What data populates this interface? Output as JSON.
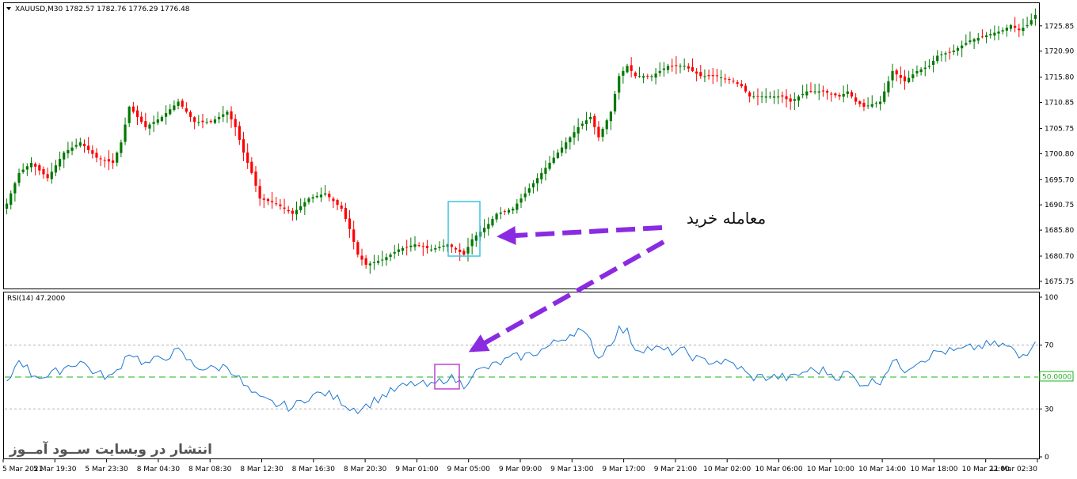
{
  "chart_data": [
    {
      "type": "candlestick",
      "symbol_header": "XAUUSD,M30  1782.57 1782.76 1776.29 1776.48",
      "ylim": [
        1674.5,
        1730
      ],
      "price_ticks": [
        "1725.85",
        "1720.90",
        "1715.80",
        "1710.85",
        "1705.75",
        "1700.80",
        "1695.70",
        "1690.75",
        "1685.80",
        "1680.70",
        "1675.75"
      ],
      "up_color": "#007800",
      "down_color": "#ff0000",
      "anchors": [
        [
          0,
          1691
        ],
        [
          3,
          1697
        ],
        [
          6,
          1699
        ],
        [
          10,
          1696
        ],
        [
          14,
          1701
        ],
        [
          18,
          1703
        ],
        [
          22,
          1700
        ],
        [
          26,
          1699
        ],
        [
          28,
          1703
        ],
        [
          30,
          1710
        ],
        [
          34,
          1706
        ],
        [
          38,
          1708
        ],
        [
          42,
          1711
        ],
        [
          46,
          1707
        ],
        [
          50,
          1707
        ],
        [
          54,
          1709
        ],
        [
          56,
          1706
        ],
        [
          58,
          1701
        ],
        [
          60,
          1697
        ],
        [
          62,
          1692
        ],
        [
          66,
          1691
        ],
        [
          70,
          1689
        ],
        [
          74,
          1692
        ],
        [
          78,
          1693
        ],
        [
          82,
          1690
        ],
        [
          84,
          1686
        ],
        [
          86,
          1681
        ],
        [
          88,
          1679
        ],
        [
          92,
          1680
        ],
        [
          96,
          1682
        ],
        [
          100,
          1683
        ],
        [
          104,
          1682
        ],
        [
          108,
          1683
        ],
        [
          110,
          1682
        ],
        [
          112,
          1681
        ],
        [
          114,
          1684
        ],
        [
          118,
          1687
        ],
        [
          120,
          1689
        ],
        [
          124,
          1690
        ],
        [
          128,
          1694
        ],
        [
          132,
          1698
        ],
        [
          136,
          1702
        ],
        [
          140,
          1706
        ],
        [
          143,
          1708
        ],
        [
          145,
          1704
        ],
        [
          148,
          1709
        ],
        [
          150,
          1716
        ],
        [
          152,
          1718
        ],
        [
          154,
          1716
        ],
        [
          158,
          1716
        ],
        [
          162,
          1718
        ],
        [
          166,
          1718
        ],
        [
          170,
          1716
        ],
        [
          174,
          1716
        ],
        [
          178,
          1715
        ],
        [
          180,
          1714
        ],
        [
          182,
          1712
        ],
        [
          186,
          1712
        ],
        [
          190,
          1712
        ],
        [
          192,
          1711
        ],
        [
          196,
          1713
        ],
        [
          200,
          1713
        ],
        [
          204,
          1712
        ],
        [
          206,
          1713
        ],
        [
          208,
          1711
        ],
        [
          210,
          1710
        ],
        [
          214,
          1711
        ],
        [
          217,
          1717
        ],
        [
          220,
          1715
        ],
        [
          223,
          1717
        ],
        [
          226,
          1718
        ],
        [
          228,
          1720
        ],
        [
          232,
          1721
        ],
        [
          236,
          1723
        ],
        [
          240,
          1724
        ],
        [
          244,
          1725
        ],
        [
          246,
          1726
        ],
        [
          248,
          1725
        ],
        [
          250,
          1726
        ],
        [
          252,
          1728
        ]
      ],
      "candle_count": 253
    },
    {
      "type": "line",
      "indicator_header": "RSI(14) 47.2000",
      "ylim": [
        0,
        100
      ],
      "rsi_ticks": [
        "100",
        "70",
        "30",
        "0"
      ],
      "levels": [
        70,
        50,
        30
      ],
      "level_label": "50.0000",
      "line_color": "#1e78d2",
      "level_color": "#22b022",
      "anchors": [
        [
          0,
          45
        ],
        [
          3,
          62
        ],
        [
          6,
          52
        ],
        [
          10,
          50
        ],
        [
          14,
          56
        ],
        [
          18,
          60
        ],
        [
          22,
          52
        ],
        [
          26,
          50
        ],
        [
          28,
          58
        ],
        [
          30,
          66
        ],
        [
          34,
          58
        ],
        [
          38,
          62
        ],
        [
          42,
          66
        ],
        [
          46,
          57
        ],
        [
          50,
          55
        ],
        [
          54,
          57
        ],
        [
          56,
          52
        ],
        [
          58,
          45
        ],
        [
          60,
          40
        ],
        [
          62,
          36
        ],
        [
          66,
          33
        ],
        [
          70,
          31
        ],
        [
          74,
          38
        ],
        [
          78,
          40
        ],
        [
          82,
          35
        ],
        [
          84,
          31
        ],
        [
          86,
          30
        ],
        [
          88,
          32
        ],
        [
          92,
          38
        ],
        [
          96,
          43
        ],
        [
          100,
          46
        ],
        [
          104,
          44
        ],
        [
          108,
          50
        ],
        [
          110,
          48
        ],
        [
          112,
          45
        ],
        [
          114,
          52
        ],
        [
          118,
          56
        ],
        [
          120,
          58
        ],
        [
          124,
          62
        ],
        [
          128,
          64
        ],
        [
          132,
          68
        ],
        [
          136,
          74
        ],
        [
          140,
          80
        ],
        [
          143,
          72
        ],
        [
          145,
          62
        ],
        [
          148,
          72
        ],
        [
          150,
          80
        ],
        [
          152,
          78
        ],
        [
          154,
          68
        ],
        [
          158,
          68
        ],
        [
          162,
          66
        ],
        [
          166,
          66
        ],
        [
          170,
          60
        ],
        [
          174,
          60
        ],
        [
          178,
          58
        ],
        [
          180,
          55
        ],
        [
          182,
          50
        ],
        [
          186,
          50
        ],
        [
          190,
          50
        ],
        [
          192,
          49
        ],
        [
          196,
          54
        ],
        [
          200,
          54
        ],
        [
          204,
          50
        ],
        [
          206,
          53
        ],
        [
          208,
          48
        ],
        [
          210,
          46
        ],
        [
          214,
          48
        ],
        [
          217,
          60
        ],
        [
          220,
          55
        ],
        [
          223,
          60
        ],
        [
          226,
          63
        ],
        [
          228,
          66
        ],
        [
          232,
          66
        ],
        [
          236,
          68
        ],
        [
          240,
          70
        ],
        [
          244,
          70
        ],
        [
          246,
          68
        ],
        [
          248,
          62
        ],
        [
          250,
          66
        ],
        [
          252,
          74
        ]
      ]
    }
  ],
  "time_labels": [
    "5 Mar 2021",
    "5 Mar 19:30",
    "5 Mar 23:30",
    "8 Mar 04:30",
    "8 Mar 08:30",
    "8 Mar 12:30",
    "8 Mar 16:30",
    "8 Mar 20:30",
    "9 Mar 01:00",
    "9 Mar 05:00",
    "9 Mar 09:00",
    "9 Mar 13:00",
    "9 Mar 17:00",
    "9 Mar 21:00",
    "10 Mar 02:00",
    "10 Mar 06:00",
    "10 Mar 10:00",
    "10 Mar 14:00",
    "10 Mar 18:00",
    "10 Mar 22:00",
    "11 Mar 02:30"
  ],
  "annotation": {
    "text": "معامله خرید",
    "arrow_color": "#8a2be2",
    "price_box_color": "#3cc3e0",
    "rsi_box_color": "#c040d0"
  },
  "watermark": "انتشار در وبسایت ســود آمــوز"
}
